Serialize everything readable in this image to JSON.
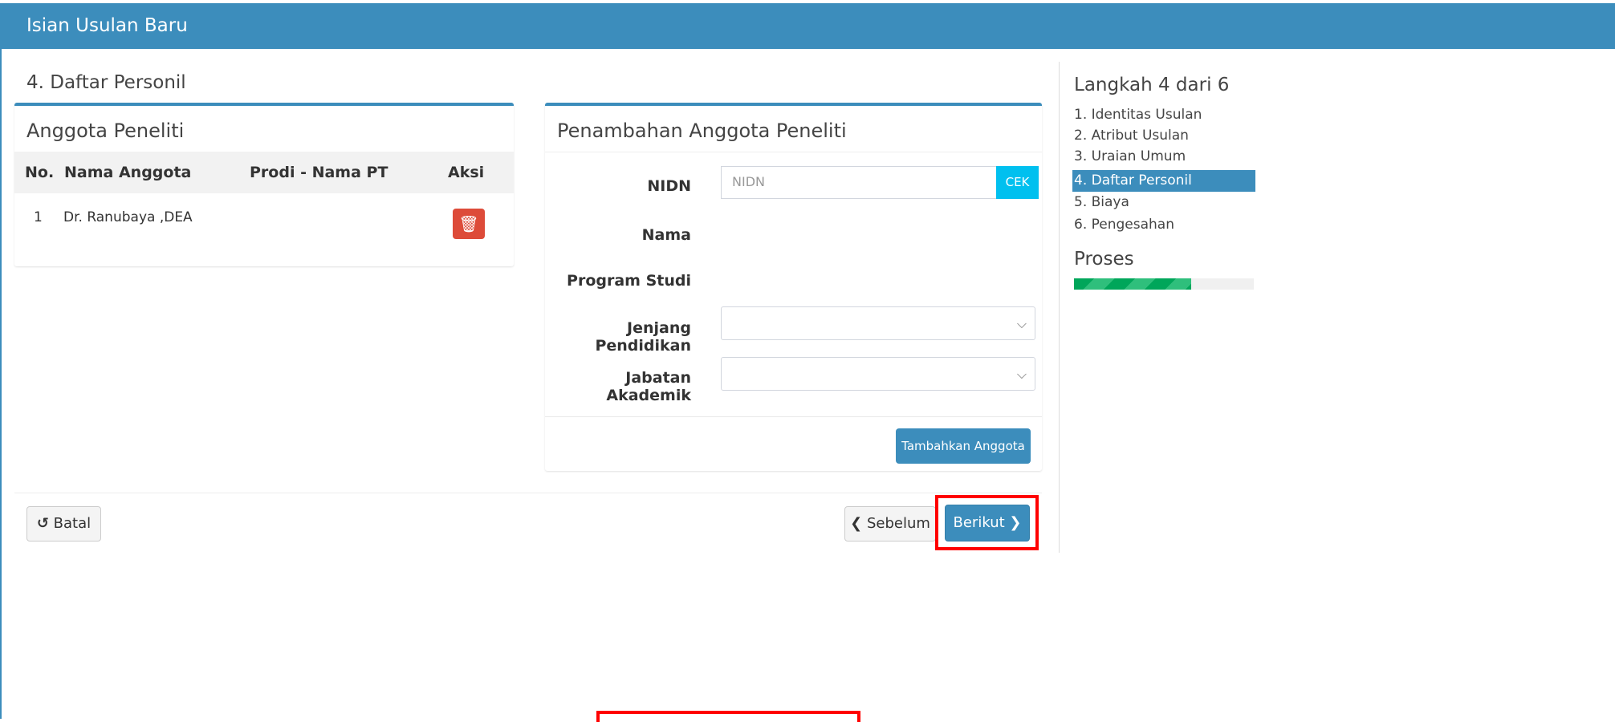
{
  "header": {
    "title": "Isian Usulan Baru"
  },
  "section": {
    "title": "4. Daftar Personil"
  },
  "anggota": {
    "title": "Anggota Peneliti",
    "columns": [
      "No.",
      "Nama Anggota",
      "Prodi - Nama PT",
      "Aksi"
    ],
    "rows": [
      {
        "no": "1",
        "nama": "Dr. Ranubaya ,DEA",
        "prodi": ""
      }
    ]
  },
  "form": {
    "title": "Penambahan Anggota Peneliti",
    "nidn_label": "NIDN",
    "nidn_placeholder": "NIDN",
    "cek_label": "CEK",
    "nama_label": "Nama",
    "prodi_label": "Program Studi",
    "jenjang_label": "Jenjang Pendidikan",
    "jabatan_label": "Jabatan Akademik",
    "add_label": "Tambahkan Anggota"
  },
  "footer": {
    "batal_label": "Batal",
    "sebelum_label": "Sebelum",
    "berikut_label": "Berikut"
  },
  "sidebar": {
    "step_title": "Langkah 4 dari 6",
    "steps": [
      {
        "label": "1. Identitas Usulan"
      },
      {
        "label": "2. Atribut Usulan"
      },
      {
        "label": "3. Uraian Umum"
      },
      {
        "label": "4. Daftar Personil"
      },
      {
        "label": "5. Biaya"
      },
      {
        "label": "6. Pengesahan"
      }
    ],
    "active_step": 4,
    "proses_title": "Proses",
    "progress_fraction": 0.65
  },
  "colors": {
    "primary": "#3c8dbc",
    "danger": "#dd4b39",
    "info": "#00c0ef",
    "success": "#00a65a",
    "highlight": "#ff0000"
  },
  "icons": [
    "trash-icon",
    "undo-icon",
    "chevron-left-icon",
    "chevron-right-icon",
    "chevron-down-icon"
  ]
}
